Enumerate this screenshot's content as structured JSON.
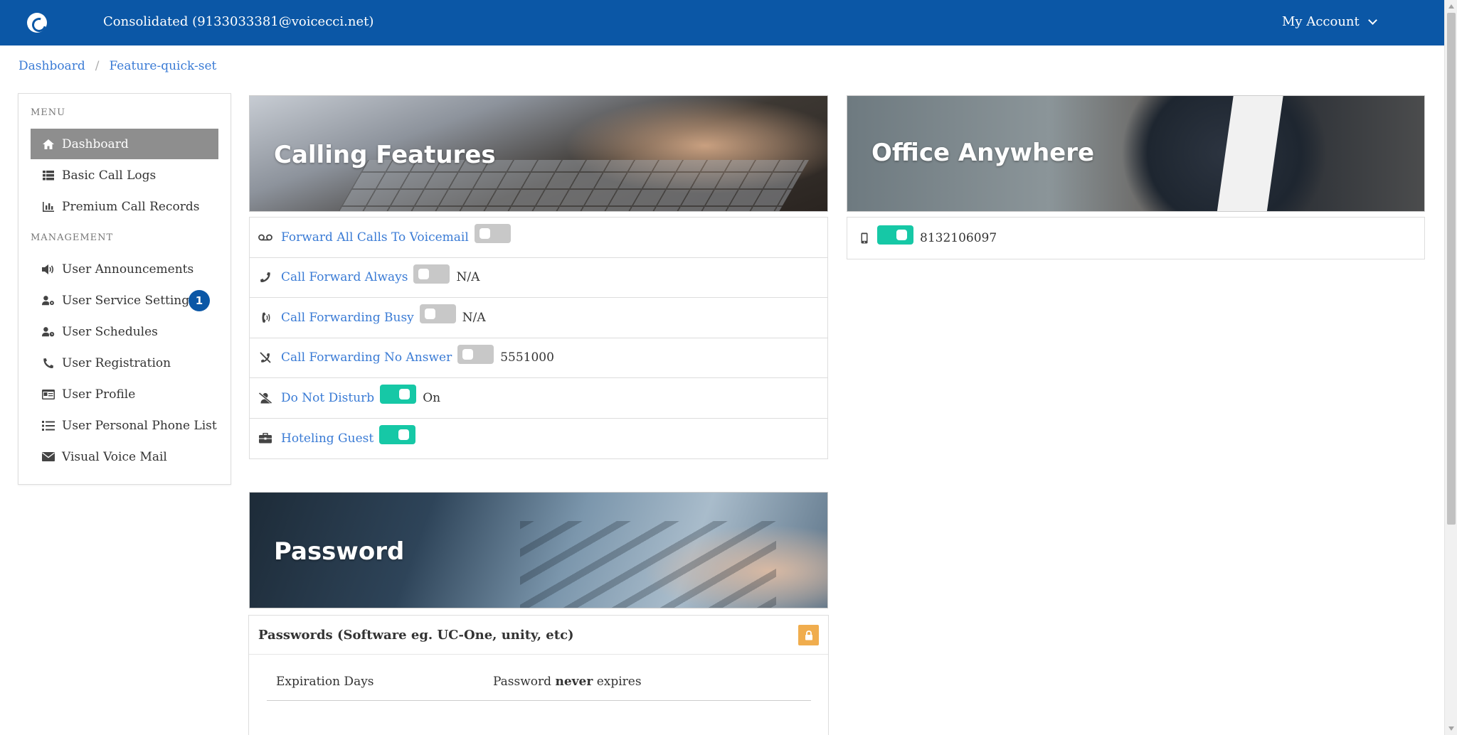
{
  "header": {
    "account_title": "Consolidated (9133033381@voicecci.net)",
    "my_account_label": "My Account",
    "brand_color": "#0b57a6"
  },
  "breadcrumb": {
    "items": [
      "Dashboard",
      "Feature-quick-set"
    ],
    "separator": "/"
  },
  "sidebar": {
    "menu_title": "MENU",
    "management_title": "MANAGEMENT",
    "menu_items": [
      {
        "label": "Dashboard",
        "icon": "home-icon",
        "active": true
      },
      {
        "label": "Basic Call Logs",
        "icon": "table-icon"
      },
      {
        "label": "Premium Call Records",
        "icon": "bar-chart-icon"
      }
    ],
    "management_items": [
      {
        "label": "User Announcements",
        "icon": "volume-icon"
      },
      {
        "label": "User Service Settings",
        "icon": "user-cog-icon",
        "badge": "1"
      },
      {
        "label": "User Schedules",
        "icon": "user-clock-icon"
      },
      {
        "label": "User Registration",
        "icon": "phone-icon"
      },
      {
        "label": "User Profile",
        "icon": "id-card-icon"
      },
      {
        "label": "User Personal Phone List",
        "icon": "list-icon"
      },
      {
        "label": "Visual Voice Mail",
        "icon": "envelope-icon"
      }
    ]
  },
  "calling_features": {
    "title": "Calling Features",
    "items": [
      {
        "label": "Forward All Calls To Voicemail",
        "icon": "voicemail-icon",
        "enabled": false,
        "value": ""
      },
      {
        "label": "Call Forward Always",
        "icon": "phone-icon",
        "enabled": false,
        "value": "N/A"
      },
      {
        "label": "Call Forwarding Busy",
        "icon": "phone-volume-icon",
        "enabled": false,
        "value": "N/A"
      },
      {
        "label": "Call Forwarding No Answer",
        "icon": "phone-slash-icon",
        "enabled": false,
        "value": "5551000"
      },
      {
        "label": "Do Not Disturb",
        "icon": "user-slash-icon",
        "enabled": true,
        "value": "On"
      },
      {
        "label": "Hoteling Guest",
        "icon": "briefcase-icon",
        "enabled": true,
        "value": ""
      }
    ]
  },
  "office_anywhere": {
    "title": "Office Anywhere",
    "number": "8132106097",
    "enabled": true,
    "icon": "mobile-icon"
  },
  "password": {
    "title": "Password",
    "card_header": "Passwords (Software eg. UC-One, unity, etc)",
    "lock_icon": "lock-icon",
    "row_label": "Expiration Days",
    "value_prefix": "Password",
    "value_bold": "never",
    "value_suffix": "expires"
  },
  "colors": {
    "toggle_on": "#16c8a6",
    "toggle_off": "#c8c8c8",
    "link": "#3a7bd5",
    "lock_button": "#f0ad4e"
  }
}
